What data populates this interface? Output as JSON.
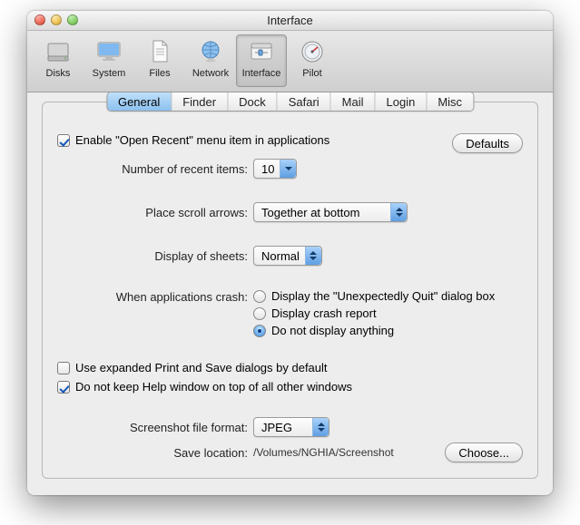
{
  "window": {
    "title": "Interface"
  },
  "toolbar": {
    "items": [
      {
        "label": "Disks"
      },
      {
        "label": "System"
      },
      {
        "label": "Files"
      },
      {
        "label": "Network"
      },
      {
        "label": "Interface"
      },
      {
        "label": "Pilot"
      }
    ],
    "selected": "Interface"
  },
  "tabs": {
    "items": [
      "General",
      "Finder",
      "Dock",
      "Safari",
      "Mail",
      "Login",
      "Misc"
    ],
    "selected": "General"
  },
  "buttons": {
    "defaults": "Defaults",
    "choose": "Choose..."
  },
  "general": {
    "enable_open_recent": {
      "label": "Enable \"Open Recent\" menu item in applications",
      "checked": true
    },
    "recent_items": {
      "label": "Number of recent items:",
      "value": "10"
    },
    "scroll_arrows": {
      "label": "Place scroll arrows:",
      "value": "Together at bottom"
    },
    "sheets": {
      "label": "Display of sheets:",
      "value": "Normal"
    },
    "crash": {
      "label": "When applications crash:",
      "options": [
        "Display the \"Unexpectedly Quit\" dialog box",
        "Display crash report",
        "Do not display anything"
      ],
      "selected_index": 2
    },
    "expanded_dialogs": {
      "label": "Use expanded Print and Save dialogs by default",
      "checked": false
    },
    "help_on_top": {
      "label": "Do not keep Help window on top of all other windows",
      "checked": true
    },
    "screenshot_format": {
      "label": "Screenshot file format:",
      "value": "JPEG"
    },
    "save_location": {
      "label": "Save location:",
      "value": "/Volumes/NGHIA/Screenshot"
    }
  }
}
